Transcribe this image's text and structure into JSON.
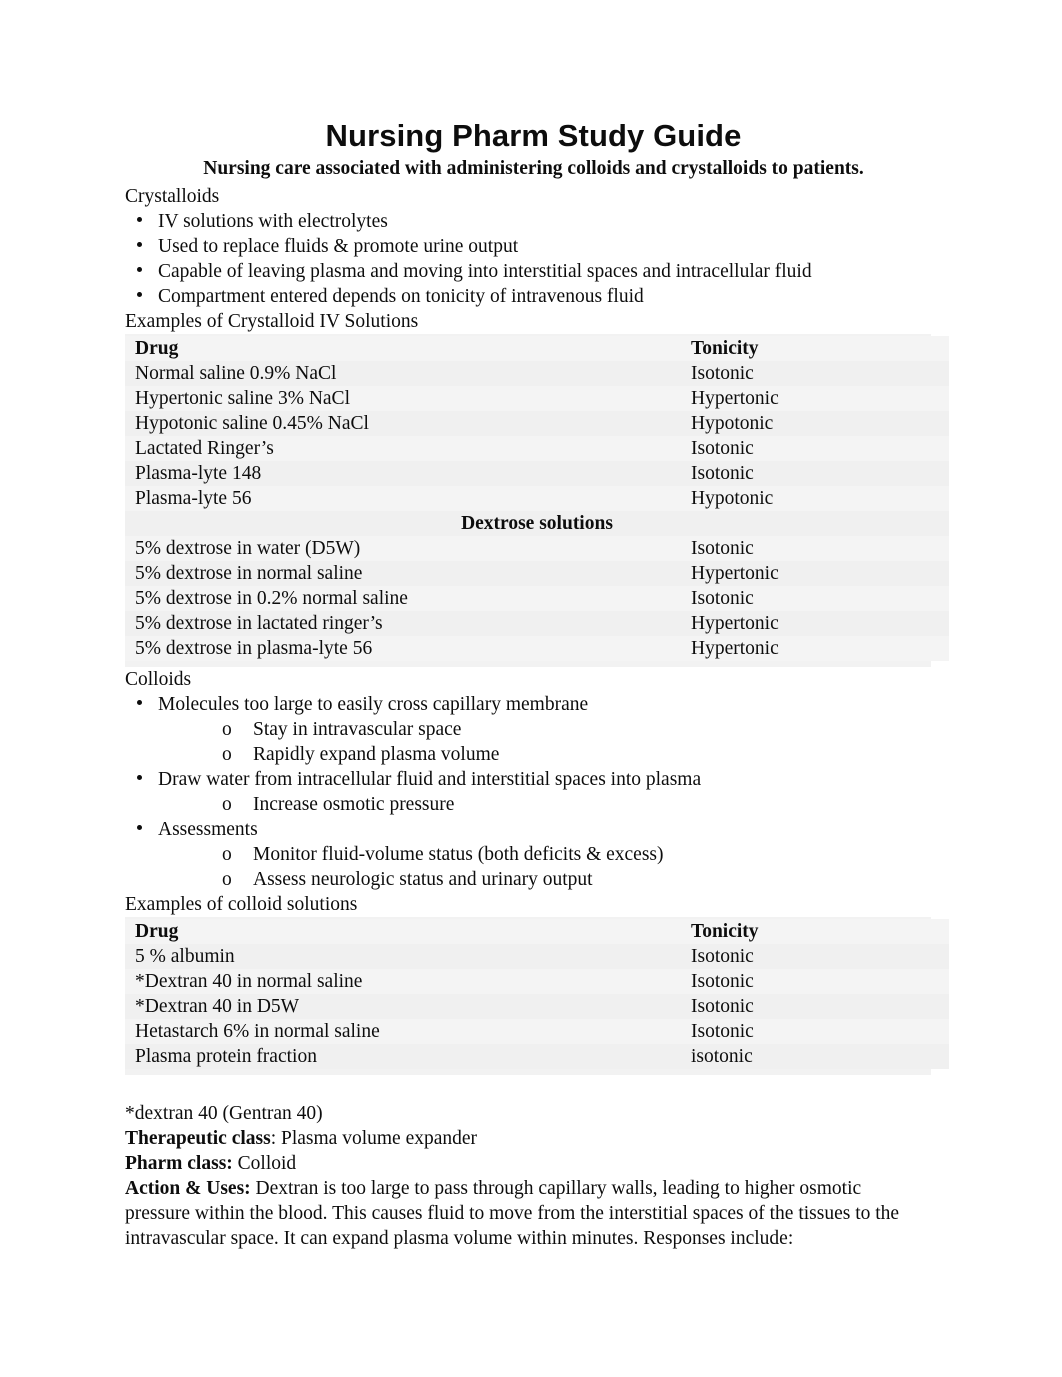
{
  "document": {
    "title": "Nursing Pharm Study Guide",
    "subtitle": "Nursing care associated with administering colloids and crystalloids to patients."
  },
  "crystalloids": {
    "heading": "Crystalloids",
    "bullets": [
      "IV solutions with electrolytes",
      "Used to replace fluids & promote urine output",
      "Capable of leaving plasma and moving into interstitial spaces and intracellular fluid",
      "Compartment entered depends on tonicity of intravenous fluid"
    ],
    "table_caption": "Examples of Crystalloid IV Solutions",
    "table": {
      "columns": [
        "Drug",
        "Tonicity"
      ],
      "rows": [
        [
          "Normal saline 0.9% NaCl",
          "Isotonic"
        ],
        [
          "Hypertonic saline 3% NaCl",
          "Hypertonic"
        ],
        [
          "Hypotonic saline 0.45% NaCl",
          "Hypotonic"
        ],
        [
          "Lactated Ringer’s",
          "Isotonic"
        ],
        [
          "Plasma-lyte 148",
          "Isotonic"
        ],
        [
          "Plasma-lyte 56",
          "Hypotonic"
        ]
      ],
      "section_header": "Dextrose solutions",
      "section_rows": [
        [
          "5% dextrose in water (D5W)",
          "Isotonic"
        ],
        [
          "5% dextrose in normal saline",
          "Hypertonic"
        ],
        [
          "5% dextrose in 0.2% normal saline",
          "Isotonic"
        ],
        [
          "5% dextrose in lactated ringer’s",
          "Hypertonic"
        ],
        [
          "5% dextrose in plasma-lyte 56",
          "Hypertonic"
        ]
      ]
    }
  },
  "colloids": {
    "heading": "Colloids",
    "bullets": [
      {
        "text": "Molecules too large to easily cross capillary membrane",
        "sub": [
          "Stay in intravascular space",
          "Rapidly expand plasma volume"
        ]
      },
      {
        "text": "Draw water from intracellular fluid and interstitial spaces into plasma",
        "sub": [
          "Increase osmotic pressure"
        ]
      },
      {
        "text": "Assessments",
        "sub": [
          "Monitor fluid-volume status (both deficits & excess)",
          "Assess neurologic status and urinary output"
        ]
      }
    ],
    "table_caption": "Examples of colloid solutions",
    "table": {
      "columns": [
        "Drug",
        "Tonicity"
      ],
      "rows": [
        [
          "5 % albumin",
          "Isotonic"
        ],
        [
          "*Dextran 40 in normal saline",
          "Isotonic"
        ],
        [
          "*Dextran 40 in D5W",
          "Isotonic"
        ],
        [
          "Hetastarch 6% in normal saline",
          "Isotonic"
        ],
        [
          "Plasma protein fraction",
          "isotonic"
        ]
      ]
    }
  },
  "footer": {
    "drug_name": "*dextran 40 (Gentran 40)",
    "therapeutic_class_label": "Therapeutic class",
    "therapeutic_class_value": ": Plasma volume expander",
    "pharm_class_label": "Pharm class:",
    "pharm_class_value": " Colloid",
    "action_label": "Action & Uses:",
    "action_value": " Dextran is too large to pass through capillary walls, leading to higher osmotic pressure within the blood. This causes fluid to move from the interstitial spaces of the tissues to the intravascular space. It can expand plasma volume within minutes. Responses include:"
  },
  "sub_bullet_marker": "o"
}
